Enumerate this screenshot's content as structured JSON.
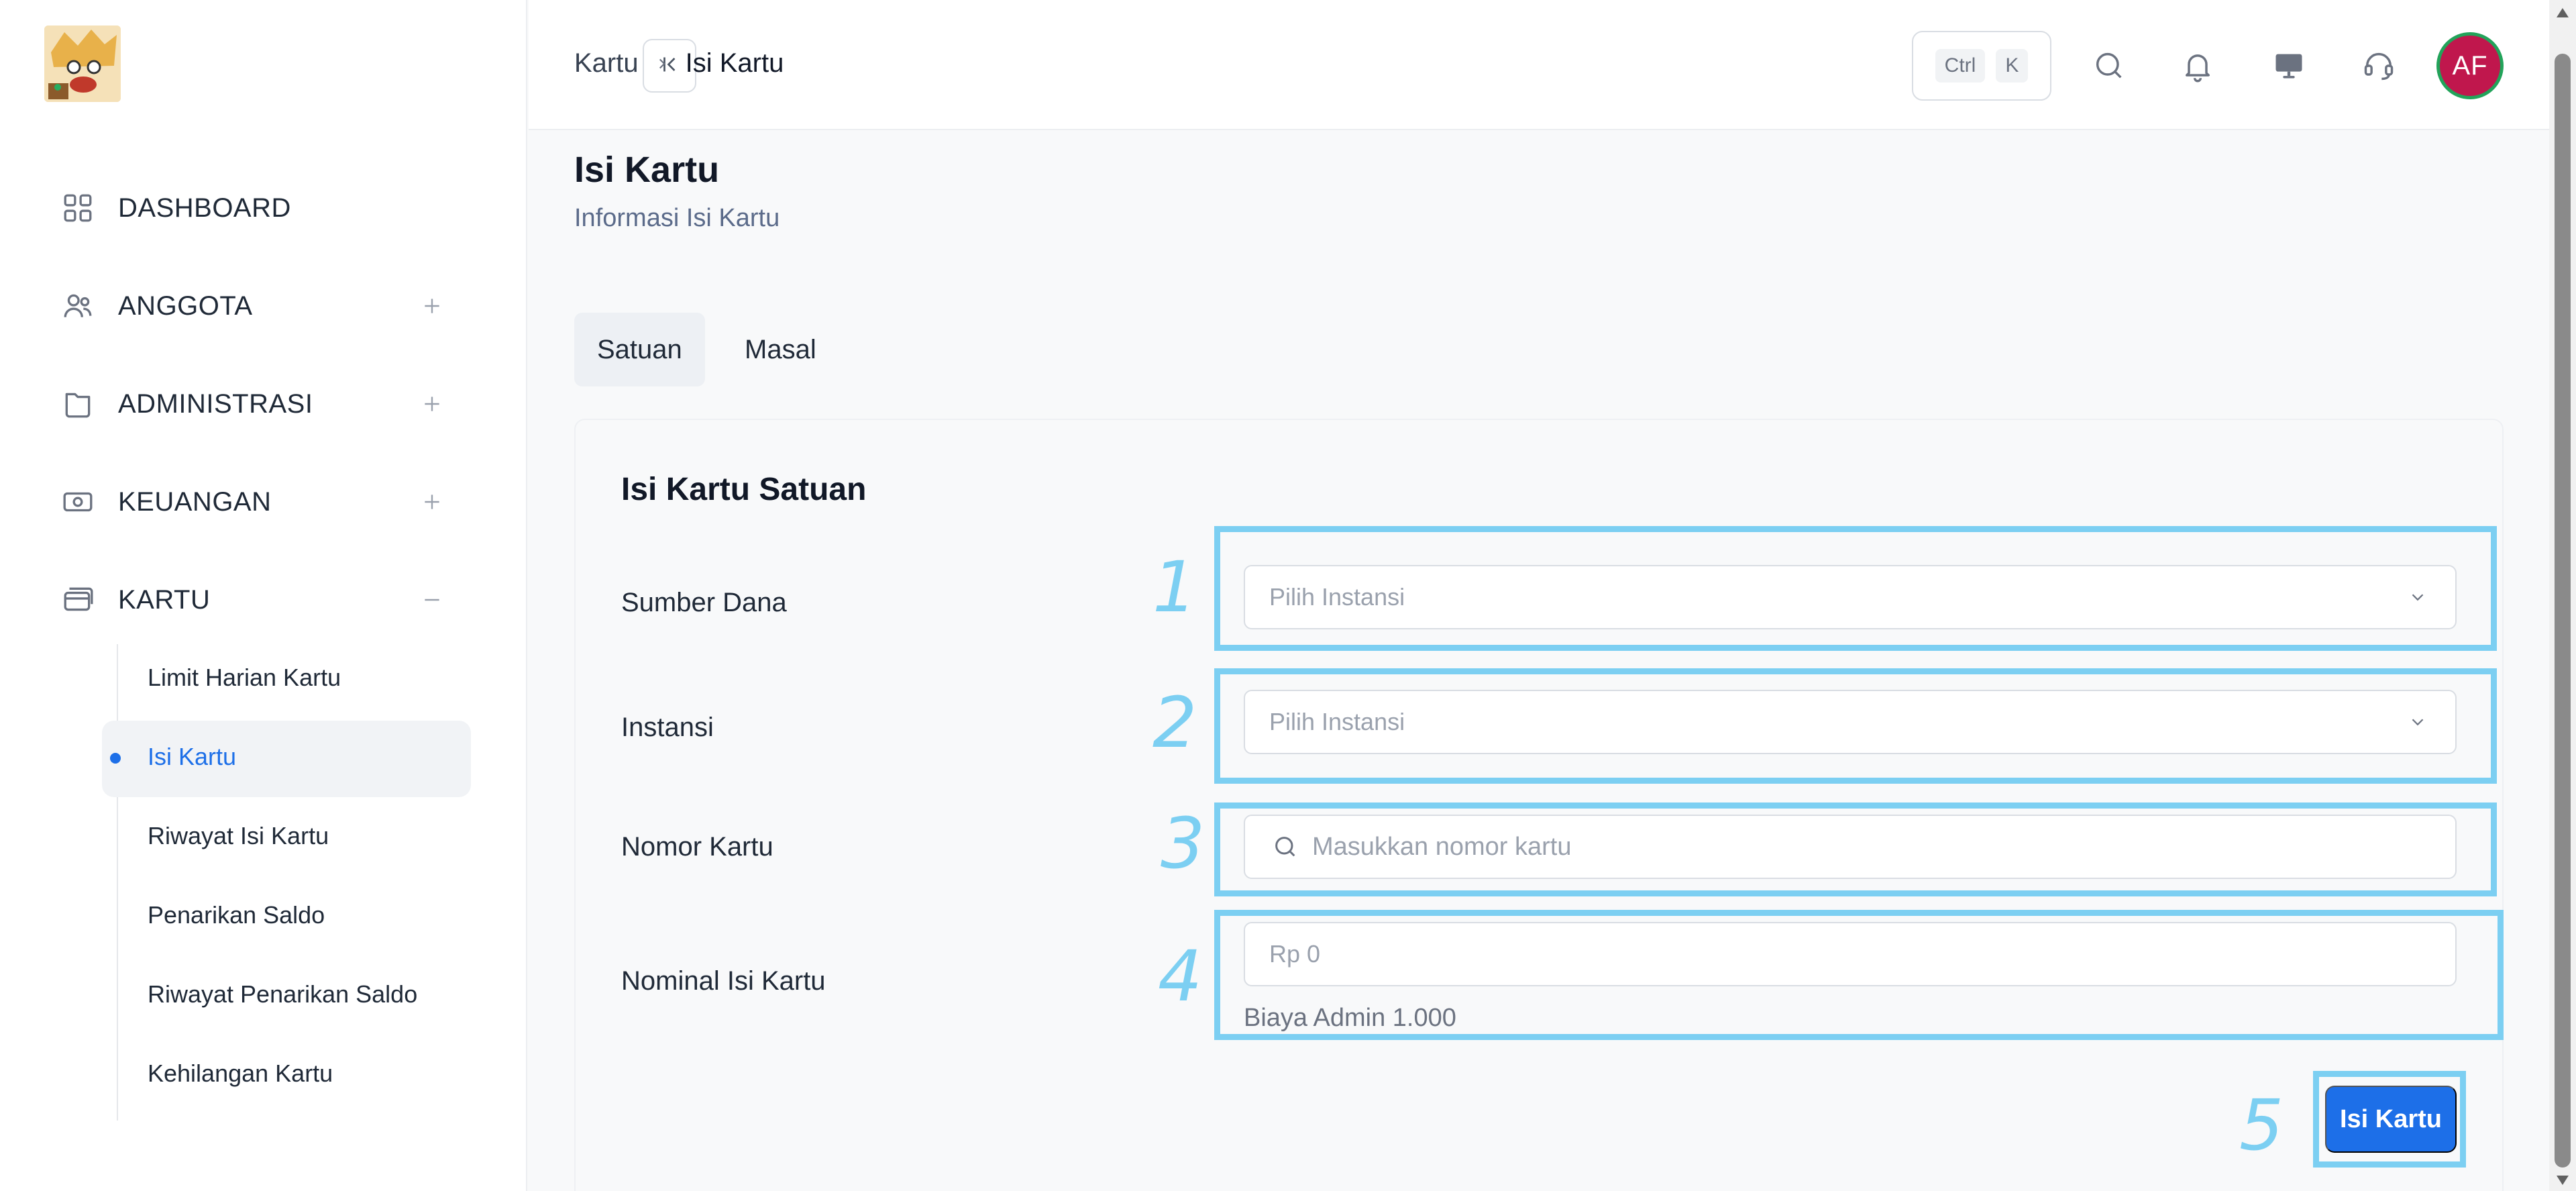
{
  "sidebar": {
    "items": [
      {
        "label": "DASHBOARD",
        "icon": "grid-icon"
      },
      {
        "label": "ANGGOTA",
        "icon": "users-icon"
      },
      {
        "label": "ADMINISTRASI",
        "icon": "folder-icon"
      },
      {
        "label": "KEUANGAN",
        "icon": "money-icon"
      },
      {
        "label": "KARTU",
        "icon": "card-icon"
      }
    ],
    "kartu_sub": [
      "Limit Harian Kartu",
      "Isi Kartu",
      "Riwayat Isi Kartu",
      "Penarikan Saldo",
      "Riwayat Penarikan Saldo",
      "Kehilangan Kartu"
    ],
    "active_sub": "Isi Kartu"
  },
  "header": {
    "breadcrumb_parent": "Kartu",
    "breadcrumb_current": "Isi Kartu",
    "kbd_ctrl": "Ctrl",
    "kbd_k": "K",
    "avatar_initials": "AF"
  },
  "page": {
    "title": "Isi Kartu",
    "subtitle": "Informasi Isi Kartu",
    "tabs": [
      "Satuan",
      "Masal"
    ],
    "active_tab": "Satuan"
  },
  "form": {
    "title": "Isi Kartu Satuan",
    "sumber_dana_label": "Sumber Dana",
    "sumber_dana_placeholder": "Pilih Instansi",
    "instansi_label": "Instansi",
    "instansi_placeholder": "Pilih Instansi",
    "nomor_kartu_label": "Nomor Kartu",
    "nomor_kartu_placeholder": "Masukkan nomor kartu",
    "nominal_label": "Nominal Isi Kartu",
    "nominal_placeholder": "Rp 0",
    "biaya_admin": "Biaya Admin 1.000",
    "submit_label": "Isi Kartu"
  },
  "annotations": [
    "1",
    "2",
    "3",
    "4",
    "5"
  ],
  "colors": {
    "accent": "#1d6fe8",
    "annotation": "#7ccff2",
    "avatar_bg": "#c0174d",
    "avatar_ring": "#22a35a"
  }
}
